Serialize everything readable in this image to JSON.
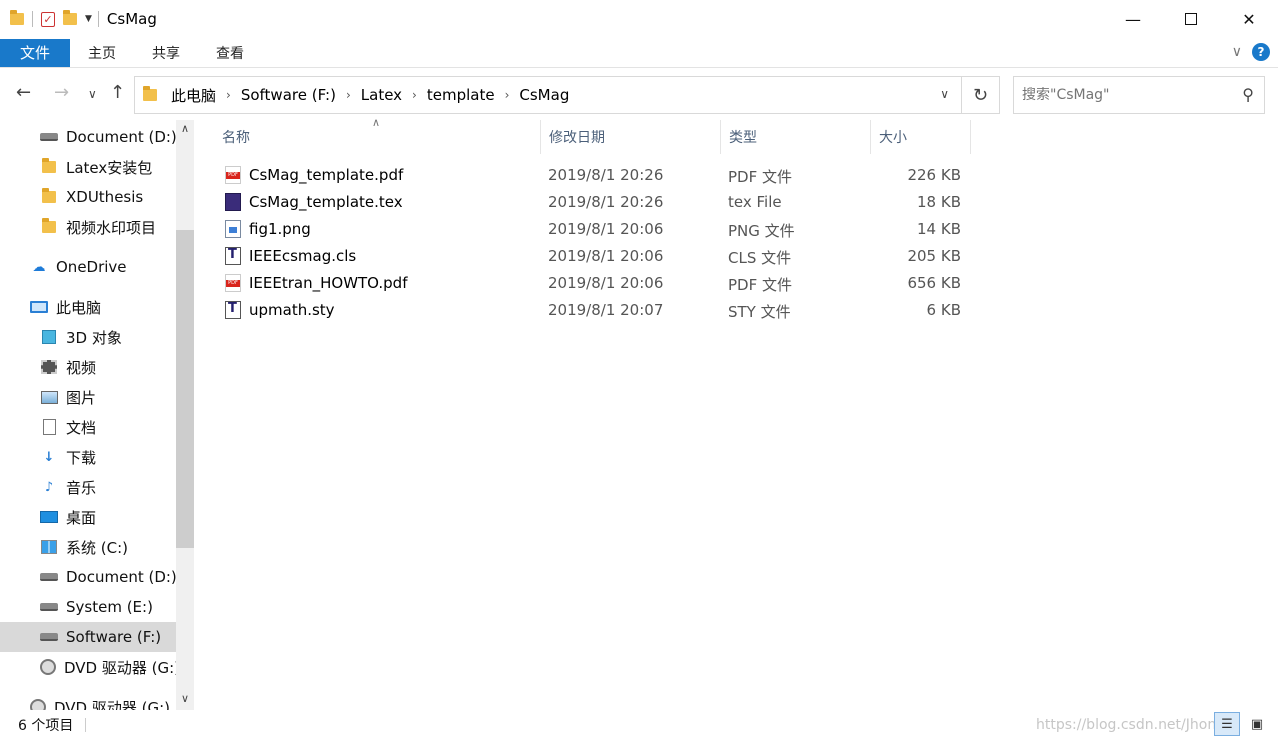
{
  "window": {
    "title": "CsMag"
  },
  "ribbon": {
    "tabs": [
      "文件",
      "主页",
      "共享",
      "查看"
    ]
  },
  "controls": {
    "minimize": "—",
    "close": "✕"
  },
  "address": {
    "crumbs": [
      "此电脑",
      "Software (F:)",
      "Latex",
      "template",
      "CsMag"
    ]
  },
  "search": {
    "placeholder": "搜索\"CsMag\""
  },
  "sidebar": {
    "items": [
      {
        "label": "Document (D:)",
        "icon": "drive-icon"
      },
      {
        "label": "Latex安装包",
        "icon": "folder-icon"
      },
      {
        "label": "XDUthesis",
        "icon": "folder-icon"
      },
      {
        "label": "视频水印项目",
        "icon": "folder-icon"
      },
      {
        "label": "OneDrive",
        "icon": "cloud-icon"
      },
      {
        "label": "此电脑",
        "icon": "pc-icon"
      },
      {
        "label": "3D 对象",
        "icon": "cube-icon"
      },
      {
        "label": "视频",
        "icon": "film-icon"
      },
      {
        "label": "图片",
        "icon": "picture-icon"
      },
      {
        "label": "文档",
        "icon": "document-icon"
      },
      {
        "label": "下载",
        "icon": "download-icon"
      },
      {
        "label": "音乐",
        "icon": "music-icon"
      },
      {
        "label": "桌面",
        "icon": "desktop-icon"
      },
      {
        "label": "系统 (C:)",
        "icon": "windows-drive-icon"
      },
      {
        "label": "Document (D:)",
        "icon": "drive-icon"
      },
      {
        "label": "System (E:)",
        "icon": "drive-icon"
      },
      {
        "label": "Software (F:)",
        "icon": "drive-icon",
        "selected": true
      },
      {
        "label": "DVD 驱动器 (G:)",
        "icon": "dvd-icon"
      },
      {
        "label": "DVD 驱动器 (G:) J",
        "icon": "dvd-icon"
      }
    ]
  },
  "list": {
    "columns": [
      "名称",
      "修改日期",
      "类型",
      "大小"
    ],
    "rows": [
      {
        "name": "CsMag_template.pdf",
        "date": "2019/8/1 20:26",
        "type": "PDF 文件",
        "size": "226 KB",
        "icon": "pdf-file-icon"
      },
      {
        "name": "CsMag_template.tex",
        "date": "2019/8/1 20:26",
        "type": "tex File",
        "size": "18 KB",
        "icon": "tex-file-icon"
      },
      {
        "name": "fig1.png",
        "date": "2019/8/1 20:06",
        "type": "PNG 文件",
        "size": "14 KB",
        "icon": "png-file-icon"
      },
      {
        "name": "IEEEcsmag.cls",
        "date": "2019/8/1 20:06",
        "type": "CLS 文件",
        "size": "205 KB",
        "icon": "cls-file-icon"
      },
      {
        "name": "IEEEtran_HOWTO.pdf",
        "date": "2019/8/1 20:06",
        "type": "PDF 文件",
        "size": "656 KB",
        "icon": "pdf-file-icon"
      },
      {
        "name": "upmath.sty",
        "date": "2019/8/1 20:07",
        "type": "STY 文件",
        "size": "6 KB",
        "icon": "sty-file-icon"
      }
    ]
  },
  "status": {
    "count": "6 个项目",
    "watermark": "https://blog.csdn.net/Jhon"
  },
  "colors": {
    "accent": "#1979ca"
  }
}
